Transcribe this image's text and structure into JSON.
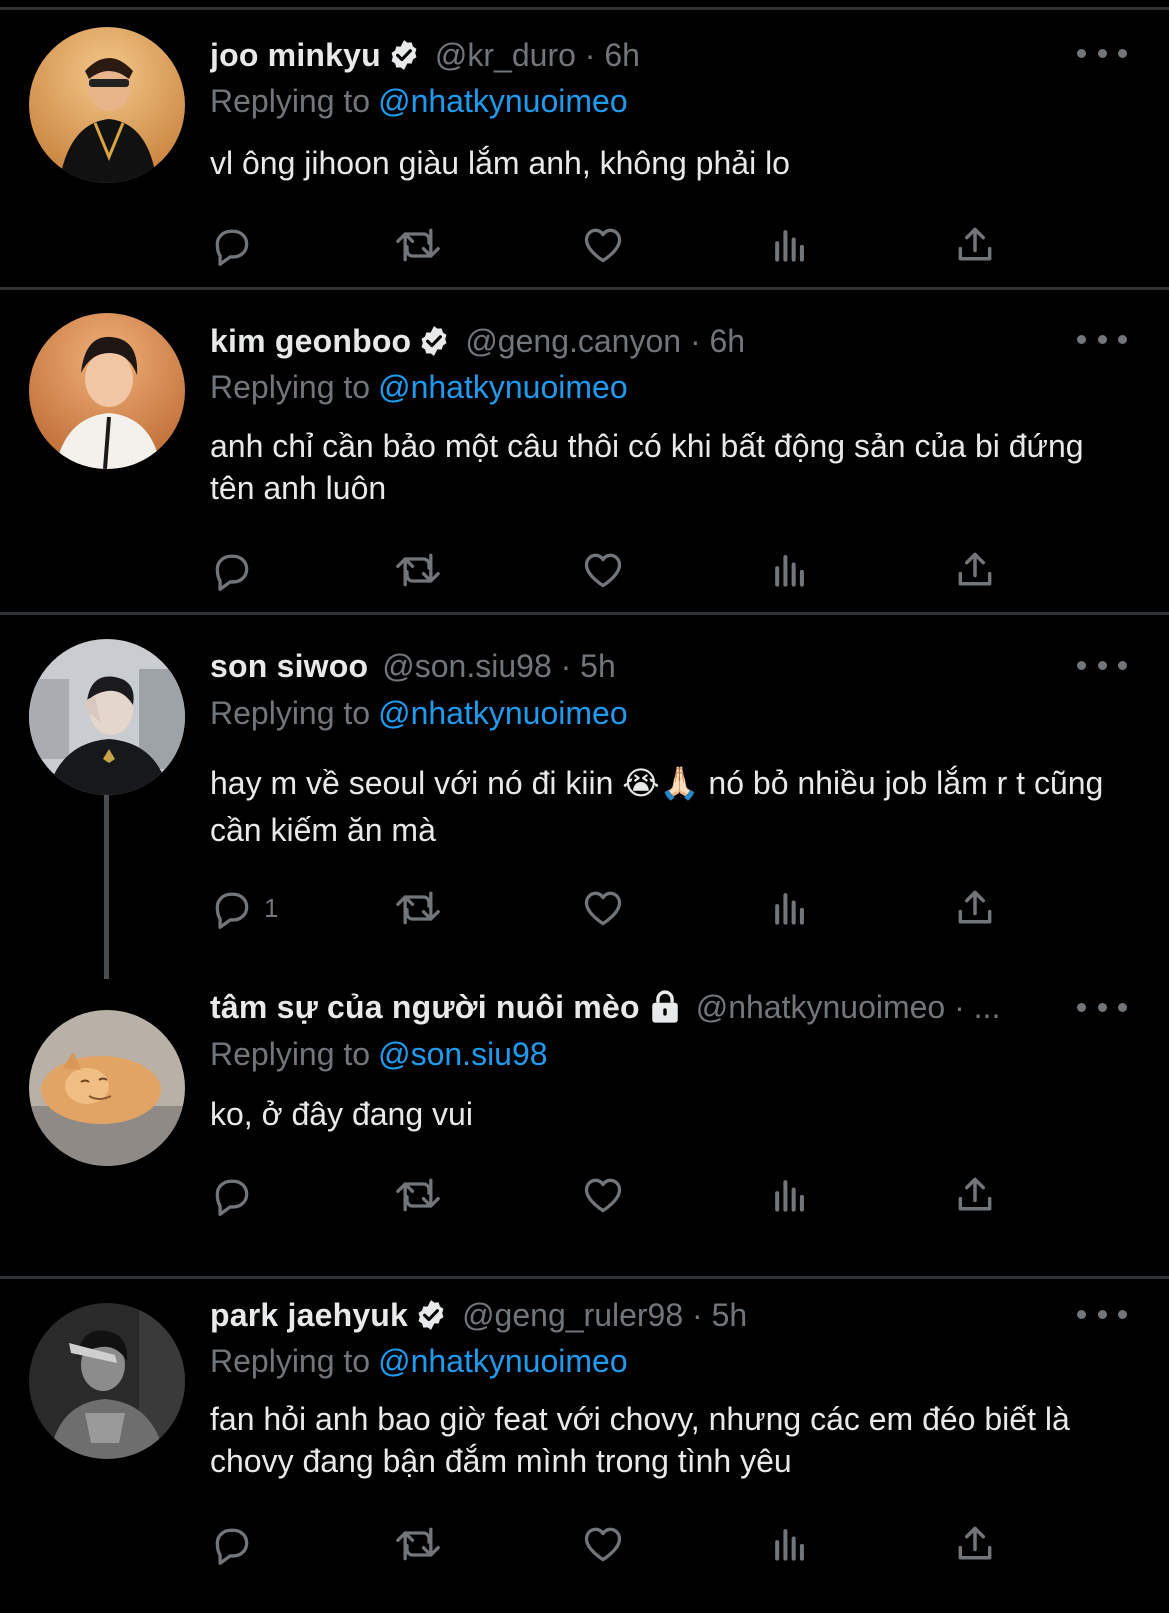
{
  "colors": {
    "background": "#000000",
    "text": "#e7e9ea",
    "muted": "#71767b",
    "link": "#1d9bf0",
    "divider": "#2f3336"
  },
  "icons": {
    "verified": "verified-badge-icon",
    "lock": "lock-icon",
    "reply": "reply-icon",
    "retweet": "retweet-icon",
    "like": "like-icon",
    "views": "views-icon",
    "share": "share-icon",
    "more": "more-icon"
  },
  "replying_label": "Replying to",
  "tweets": [
    {
      "name": "joo minkyu",
      "verified": true,
      "handle": "@kr_duro · 6h",
      "reply_to": "@nhatkynuoimeo",
      "text": "vl ông jihoon giàu lắm anh, không phải lo"
    },
    {
      "name": "kim geonboo",
      "verified": true,
      "handle": "@geng.canyon · 6h",
      "reply_to": "@nhatkynuoimeo",
      "text": "anh chỉ cần bảo một câu thôi có khi bất động sản của bi đứng tên anh luôn"
    },
    {
      "name": "son siwoo",
      "verified": false,
      "handle": "@son.siu98 · 5h",
      "reply_to": "@nhatkynuoimeo",
      "text": "hay m về seoul với nó đi kiin 😭🙏🏻 nó bỏ nhiều job lắm r t cũng cần kiếm ăn mà",
      "reply_count": "1"
    },
    {
      "name": "tâm sự của người nuôi mèo",
      "locked": true,
      "handle": "@nhatkynuoimeo · ...",
      "reply_to": "@son.siu98",
      "text": "ko, ở đây đang vui"
    },
    {
      "name": "park jaehyuk",
      "verified": true,
      "handle": "@geng_ruler98 · 5h",
      "reply_to": "@nhatkynuoimeo",
      "text": "fan hỏi anh bao giờ feat với chovy, nhưng các em đéo biết là chovy đang bận đắm mình trong tình yêu"
    }
  ]
}
